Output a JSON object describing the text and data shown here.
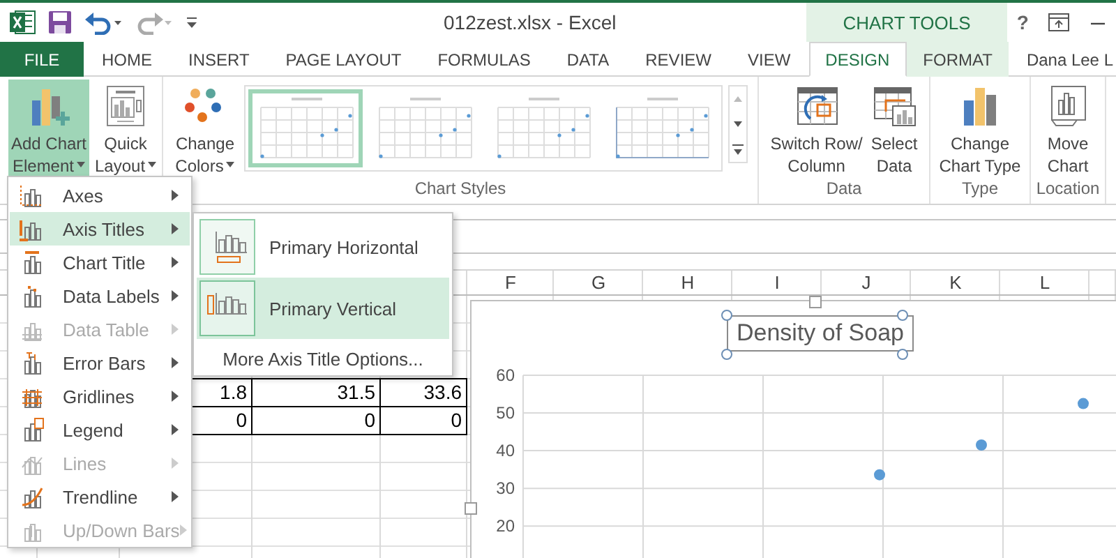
{
  "title_bar": {
    "title": "012zest.xlsx - Excel",
    "context_label": "CHART TOOLS",
    "help": "?"
  },
  "tabs": [
    {
      "label": "FILE",
      "kind": "file",
      "selected": false
    },
    {
      "label": "HOME",
      "kind": "main",
      "selected": false
    },
    {
      "label": "INSERT",
      "kind": "main",
      "selected": false
    },
    {
      "label": "PAGE LAYOUT",
      "kind": "main",
      "selected": false
    },
    {
      "label": "FORMULAS",
      "kind": "main",
      "selected": false
    },
    {
      "label": "DATA",
      "kind": "main",
      "selected": false
    },
    {
      "label": "REVIEW",
      "kind": "main",
      "selected": false
    },
    {
      "label": "VIEW",
      "kind": "main",
      "selected": false
    },
    {
      "label": "DESIGN",
      "kind": "context",
      "selected": true
    },
    {
      "label": "FORMAT",
      "kind": "context",
      "selected": false
    }
  ],
  "user": "Dana Lee L",
  "ribbon": {
    "groups": [
      {
        "buttons": [
          {
            "lines": [
              "Add Chart",
              "Element"
            ],
            "dropdown": true,
            "pressed": true
          },
          {
            "lines": [
              "Quick",
              "Layout"
            ],
            "dropdown": true,
            "pressed": false
          }
        ]
      },
      {
        "label": "Chart Styles",
        "buttons": [
          {
            "lines": [
              "Change",
              "Colors"
            ],
            "dropdown": true,
            "pressed": false
          }
        ],
        "styles": [
          {
            "selected": true
          },
          {
            "selected": false
          },
          {
            "selected": false
          },
          {
            "selected": false
          }
        ]
      },
      {
        "label": "Data",
        "buttons": [
          {
            "lines": [
              "Switch Row/",
              "Column"
            ],
            "dropdown": false,
            "pressed": false
          },
          {
            "lines": [
              "Select",
              "Data"
            ],
            "dropdown": false,
            "pressed": false
          }
        ]
      },
      {
        "label": "Type",
        "buttons": [
          {
            "lines": [
              "Change",
              "Chart Type"
            ],
            "dropdown": false,
            "pressed": false
          }
        ]
      },
      {
        "label": "Location",
        "buttons": [
          {
            "lines": [
              "Move",
              "Chart"
            ],
            "dropdown": false,
            "pressed": false
          }
        ]
      }
    ]
  },
  "sheet": {
    "columns": [
      "F",
      "G",
      "H",
      "I",
      "J",
      "K",
      "L"
    ],
    "rows": [
      [
        "1.8",
        "31.5",
        "33.6"
      ],
      [
        "0",
        "0",
        "0"
      ]
    ]
  },
  "chart": {
    "title": "Density of Soap",
    "chart_data": {
      "type": "scatter",
      "ylim": [
        9.3,
        60
      ],
      "grid": true,
      "yticks": [
        20,
        30,
        40,
        50,
        60
      ],
      "categories": [
        null,
        null,
        null,
        null,
        null,
        null
      ],
      "series": [
        {
          "color": "#5b9bd5",
          "values": [
            null,
            null,
            null,
            33.6,
            41.5,
            52.5
          ]
        }
      ]
    }
  },
  "menu": {
    "items": [
      {
        "label": "Axes",
        "selected": false,
        "disabled": false
      },
      {
        "label": "Axis Titles",
        "selected": true,
        "disabled": false
      },
      {
        "label": "Chart Title",
        "selected": false,
        "disabled": false
      },
      {
        "label": "Data Labels",
        "selected": false,
        "disabled": false
      },
      {
        "label": "Data Table",
        "selected": false,
        "disabled": true
      },
      {
        "label": "Error Bars",
        "selected": false,
        "disabled": false
      },
      {
        "label": "Gridlines",
        "selected": false,
        "disabled": false
      },
      {
        "label": "Legend",
        "selected": false,
        "disabled": false
      },
      {
        "label": "Lines",
        "selected": false,
        "disabled": true
      },
      {
        "label": "Trendline",
        "selected": false,
        "disabled": false
      },
      {
        "label": "Up/Down Bars",
        "selected": false,
        "disabled": true
      }
    ]
  },
  "submenu": {
    "items": [
      {
        "label": "Primary Horizontal",
        "kind": "option",
        "selected": false
      },
      {
        "label": "Primary Vertical",
        "kind": "option",
        "selected": true
      },
      {
        "label": "More Axis Title Options...",
        "kind": "link",
        "selected": false
      }
    ]
  }
}
